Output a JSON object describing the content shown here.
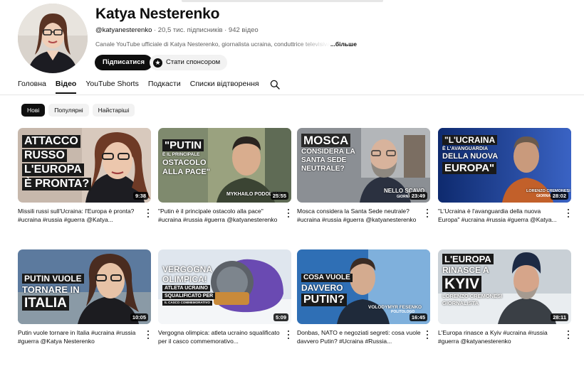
{
  "channel": {
    "name": "Katya Nesterenko",
    "handle": "@katyanesterenko",
    "stats": "· 20,5 тис. підписників · 942 відео",
    "description": "Canale YouTube ufficiale di Katya Nesterenko, giornalista ucraina, conduttrice televisiva",
    "more": "...більше",
    "subscribe_label": "Підписатися",
    "sponsor_label": "Стати спонсором"
  },
  "tabs": [
    "Головна",
    "Відео",
    "YouTube Shorts",
    "Подкасти",
    "Списки відтворення"
  ],
  "active_tab": "Відео",
  "chips": [
    "Нові",
    "Популярні",
    "Найстаріші"
  ],
  "active_chip": "Нові",
  "videos": [
    {
      "title": "Missili russi sull'Ucraina: l'Europa è pronta? #ucraina #russia #guerra @Katya...",
      "duration": "9:38",
      "caption": [
        "ATTACCO",
        "RUSSO",
        "L'EUROPA",
        "È PRONTA?"
      ],
      "overlay_name": "",
      "overlay_role": ""
    },
    {
      "title": "\"Putin è il principale ostacolo alla pace\" #ucraina #russia #guerra @katyanesterenko",
      "duration": "25:55",
      "caption": [
        "\"PUTIN",
        "È IL PRINCIPALE",
        "OSTACOLO",
        "ALLA PACE\""
      ],
      "overlay_name": "MYKHAILO PODOLYAK",
      "overlay_role": ""
    },
    {
      "title": "Mosca considera la Santa Sede neutrale? #ucraina #russia #guerra @katyanesterenko",
      "duration": "23:49",
      "caption": [
        "MOSCA",
        "CONSIDERA LA",
        "SANTA SEDE",
        "NEUTRALE?"
      ],
      "overlay_name": "NELLO SCAVO",
      "overlay_role": "GIORNALISTA"
    },
    {
      "title": "\"L'Ucraina è l'avanguardia della nuova Europa\" #ucraina #russia #guerra @Katya...",
      "duration": "28:02",
      "caption": [
        "\"L'UCRAINA",
        "È L'AVANGUARDIA",
        "DELLA NUOVA",
        "EUROPA\""
      ],
      "overlay_name": "LORENZO CREMONESI",
      "overlay_role": "GIORNALI..."
    },
    {
      "title": "Putin vuole tornare in Italia #ucraina #russia #guerra @Katya Nesterenko",
      "duration": "10:05",
      "caption": [
        "PUTIN VUOLE",
        "TORNARE IN",
        "ITALIA"
      ],
      "overlay_name": "",
      "overlay_role": ""
    },
    {
      "title": "Vergogna olimpica: atleta ucraino squalificato per il casco commemorativo...",
      "duration": "5:09",
      "caption": [
        "VERGOGNA",
        "OLIMPICA!",
        "ATLETA UCRAINO",
        "SQUALIFICATO PER",
        "IL CASCO COMMEMORATIVO"
      ],
      "overlay_name": "",
      "overlay_role": ""
    },
    {
      "title": "Donbas, NATO e negoziati segreti: cosa vuole davvero Putin? #Ucraina #Russia...",
      "duration": "16:45",
      "caption": [
        "COSA VUOLE",
        "DAVVERO",
        "PUTIN?"
      ],
      "overlay_name": "VOLODYMYR FESENKO",
      "overlay_role": "POLITOLOGO"
    },
    {
      "title": "L'Europa rinasce a Kyiv #ucraina #russia #guerra @katyanesterenko",
      "duration": "28:11",
      "caption": [
        "L'EUROPA",
        "RINASCE A",
        "KYIV",
        "LORENZO CREMONESI",
        "GIORNALISTA"
      ],
      "overlay_name": "",
      "overlay_role": ""
    }
  ],
  "colors": {
    "accent_dark": "#0f0f0f",
    "secondary_text": "#606060",
    "chip_bg": "#f2f2f2"
  }
}
